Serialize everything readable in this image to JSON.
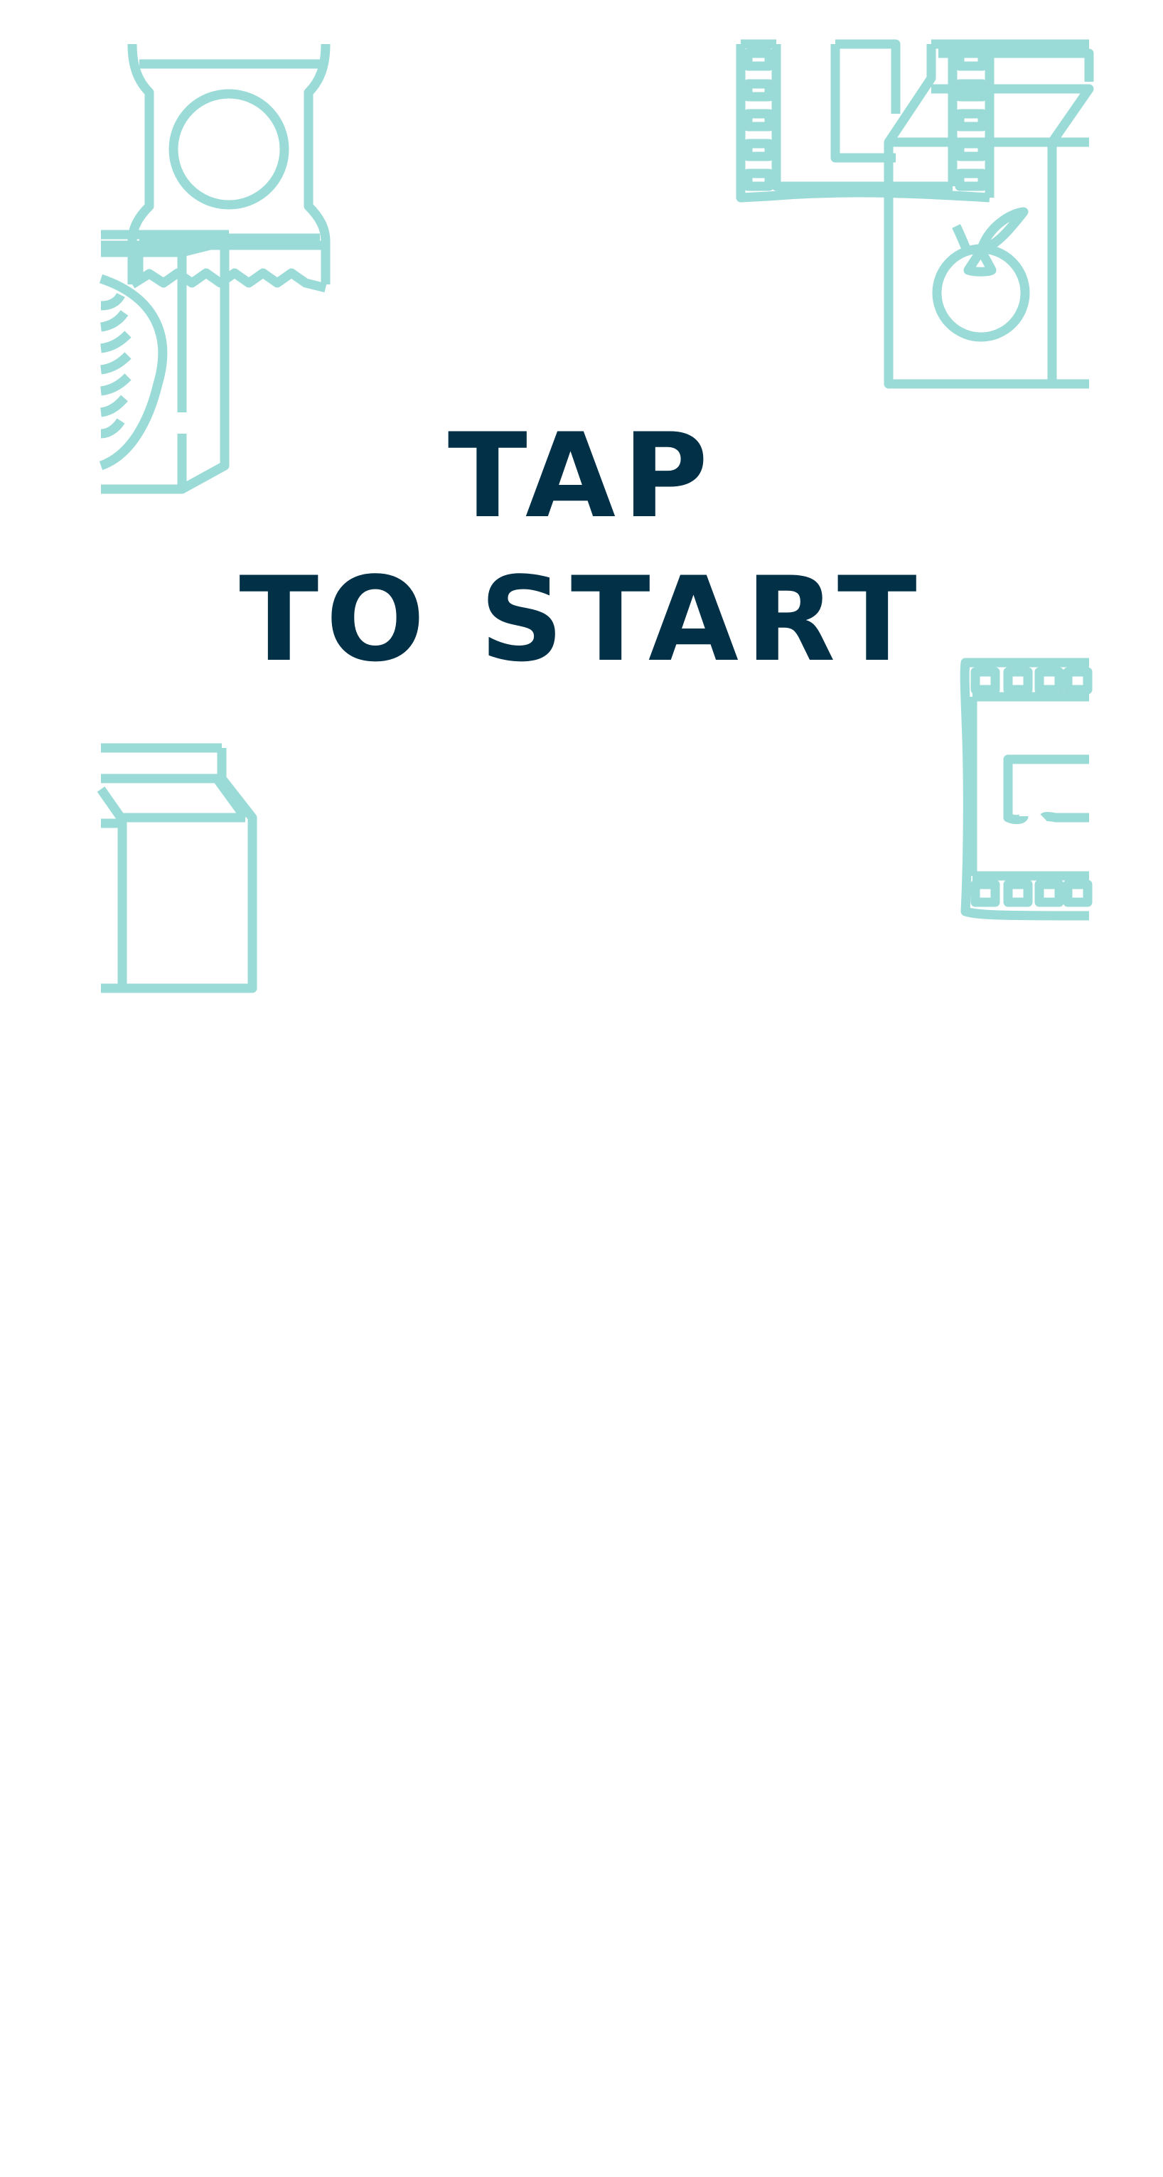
{
  "start_screen": {
    "title_line_1": "TAP",
    "title_line_2": "TO START"
  },
  "colors": {
    "background": "#ffffff",
    "title": "#023047",
    "icon": "#9adbd7"
  },
  "icons": [
    "candy-bar-icon",
    "milk-carton-icon",
    "cereal-box-icon",
    "pasta-box-icon",
    "peach-box-icon",
    "popcorn-box-icon",
    "fig-bar-icon"
  ]
}
